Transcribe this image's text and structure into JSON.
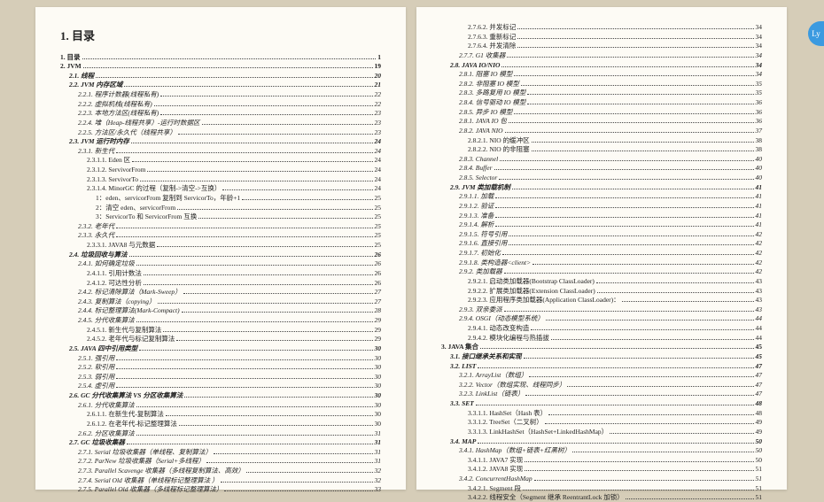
{
  "title": "1. 目录",
  "assist_label": "Ly",
  "left": [
    {
      "lvl": 0,
      "label": "1. 目录",
      "page": "1"
    },
    {
      "lvl": 0,
      "label": "2. JVM",
      "page": "19"
    },
    {
      "lvl": 1,
      "label": "2.1. 线程",
      "page": "20"
    },
    {
      "lvl": 1,
      "label": "2.2. JVM 内存区域",
      "page": "21"
    },
    {
      "lvl": 2,
      "label": "2.2.1. 程序计数器(线程私有)",
      "page": "22"
    },
    {
      "lvl": 2,
      "label": "2.2.2. 虚拟机栈(线程私有)",
      "page": "22"
    },
    {
      "lvl": 2,
      "label": "2.2.3. 本地方法区(线程私有)",
      "page": "23"
    },
    {
      "lvl": 2,
      "label": "2.2.4. 堆（Heap-线程共享）-运行时数据区",
      "page": "23"
    },
    {
      "lvl": 2,
      "label": "2.2.5. 方法区/永久代（线程共享）",
      "page": "23"
    },
    {
      "lvl": 1,
      "label": "2.3. JVM 运行时内存",
      "page": "24"
    },
    {
      "lvl": 2,
      "label": "2.3.1. 新生代",
      "page": "24"
    },
    {
      "lvl": 3,
      "label": "2.3.1.1. Eden 区",
      "page": "24"
    },
    {
      "lvl": 3,
      "label": "2.3.1.2. ServivorFrom",
      "page": "24"
    },
    {
      "lvl": 3,
      "label": "2.3.1.3. ServivorTo",
      "page": "24"
    },
    {
      "lvl": 3,
      "label": "2.3.1.4. MinorGC 的过程（复制->清空->互换）",
      "page": "24"
    },
    {
      "lvl": 4,
      "label": "1：eden、servicorFrom 复制到 ServicorTo，年龄+1",
      "page": "25"
    },
    {
      "lvl": 4,
      "label": "2：清空 eden、servicorFrom",
      "page": "25"
    },
    {
      "lvl": 4,
      "label": "3：ServicorTo 和 ServicorFrom 互换",
      "page": "25"
    },
    {
      "lvl": 2,
      "label": "2.3.2. 老年代",
      "page": "25"
    },
    {
      "lvl": 2,
      "label": "2.3.3. 永久代",
      "page": "25"
    },
    {
      "lvl": 3,
      "label": "2.3.3.1. JAVA8 与元数据",
      "page": "25"
    },
    {
      "lvl": 1,
      "label": "2.4. 垃圾回收与算法",
      "page": "26"
    },
    {
      "lvl": 2,
      "label": "2.4.1. 如何确定垃圾",
      "page": "26"
    },
    {
      "lvl": 3,
      "label": "2.4.1.1. 引用计数法",
      "page": "26"
    },
    {
      "lvl": 3,
      "label": "2.4.1.2. 可达性分析",
      "page": "26"
    },
    {
      "lvl": 2,
      "label": "2.4.2. 标记清除算法（Mark-Sweep）",
      "page": "27"
    },
    {
      "lvl": 2,
      "label": "2.4.3. 复制算法（copying）",
      "page": "27"
    },
    {
      "lvl": 2,
      "label": "2.4.4. 标记整理算法(Mark-Compact)",
      "page": "28"
    },
    {
      "lvl": 2,
      "label": "2.4.5. 分代收集算法",
      "page": "29"
    },
    {
      "lvl": 3,
      "label": "2.4.5.1. 新生代与复制算法",
      "page": "29"
    },
    {
      "lvl": 3,
      "label": "2.4.5.2. 老年代与标记复制算法",
      "page": "29"
    },
    {
      "lvl": 1,
      "label": "2.5. JAVA 四中引用类型",
      "page": "30"
    },
    {
      "lvl": 2,
      "label": "2.5.1. 强引用",
      "page": "30"
    },
    {
      "lvl": 2,
      "label": "2.5.2. 软引用",
      "page": "30"
    },
    {
      "lvl": 2,
      "label": "2.5.3. 弱引用",
      "page": "30"
    },
    {
      "lvl": 2,
      "label": "2.5.4. 虚引用",
      "page": "30"
    },
    {
      "lvl": 1,
      "label": "2.6. GC 分代收集算法 VS 分区收集算法",
      "page": "30"
    },
    {
      "lvl": 2,
      "label": "2.6.1. 分代收集算法",
      "page": "30"
    },
    {
      "lvl": 3,
      "label": "2.6.1.1. 在新生代-复制算法",
      "page": "30"
    },
    {
      "lvl": 3,
      "label": "2.6.1.2. 在老年代-标记整理算法",
      "page": "30"
    },
    {
      "lvl": 2,
      "label": "2.6.2. 分区收集算法",
      "page": "31"
    },
    {
      "lvl": 1,
      "label": "2.7. GC 垃圾收集器",
      "page": "31"
    },
    {
      "lvl": 2,
      "label": "2.7.1. Serial 垃圾收集器（单线程、复制算法）",
      "page": "31"
    },
    {
      "lvl": 2,
      "label": "2.7.2. ParNew 垃圾收集器（Serial+多线程）",
      "page": "31"
    },
    {
      "lvl": 2,
      "label": "2.7.3. Parallel Scavenge 收集器（多线程复制算法、高效）",
      "page": "32"
    },
    {
      "lvl": 2,
      "label": "2.7.4. Serial Old 收集器（单线程标记整理算法 ）",
      "page": "32"
    },
    {
      "lvl": 2,
      "label": "2.7.5. Parallel Old 收集器（多线程标记整理算法）",
      "page": "33"
    }
  ],
  "right": [
    {
      "lvl": 3,
      "label": "2.7.6.2. 并发标记",
      "page": "34"
    },
    {
      "lvl": 3,
      "label": "2.7.6.3. 重新标记",
      "page": "34"
    },
    {
      "lvl": 3,
      "label": "2.7.6.4. 并发清除",
      "page": "34"
    },
    {
      "lvl": 2,
      "label": "2.7.7. G1 收集器",
      "page": "34"
    },
    {
      "lvl": 1,
      "label": "2.8. JAVA IO/NIO",
      "page": "34"
    },
    {
      "lvl": 2,
      "label": "2.8.1. 阻塞 IO 模型",
      "page": "34"
    },
    {
      "lvl": 2,
      "label": "2.8.2. 非阻塞 IO 模型",
      "page": "35"
    },
    {
      "lvl": 2,
      "label": "2.8.3. 多路复用 IO 模型",
      "page": "35"
    },
    {
      "lvl": 2,
      "label": "2.8.4. 信号驱动 IO 模型",
      "page": "36"
    },
    {
      "lvl": 2,
      "label": "2.8.5. 异步 IO 模型",
      "page": "36"
    },
    {
      "lvl": 2,
      "label": "2.8.1. JAVA IO 包",
      "page": "36"
    },
    {
      "lvl": 2,
      "label": "2.8.2. JAVA NIO",
      "page": "37"
    },
    {
      "lvl": 3,
      "label": "2.8.2.1. NIO 的缓冲区",
      "page": "38"
    },
    {
      "lvl": 3,
      "label": "2.8.2.2. NIO 的非阻塞",
      "page": "38"
    },
    {
      "lvl": 2,
      "label": "2.8.3. Channel",
      "page": "40"
    },
    {
      "lvl": 2,
      "label": "2.8.4. Buffer",
      "page": "40"
    },
    {
      "lvl": 2,
      "label": "2.8.5. Selector",
      "page": "40"
    },
    {
      "lvl": 1,
      "label": "2.9. JVM 类加载机制",
      "page": "41"
    },
    {
      "lvl": 2,
      "label": "2.9.1.1. 加载",
      "page": "41"
    },
    {
      "lvl": 2,
      "label": "2.9.1.2. 验证",
      "page": "41"
    },
    {
      "lvl": 2,
      "label": "2.9.1.3. 准备",
      "page": "41"
    },
    {
      "lvl": 2,
      "label": "2.9.1.4. 解析",
      "page": "41"
    },
    {
      "lvl": 2,
      "label": "2.9.1.5. 符号引用",
      "page": "42"
    },
    {
      "lvl": 2,
      "label": "2.9.1.6. 直接引用",
      "page": "42"
    },
    {
      "lvl": 2,
      "label": "2.9.1.7. 初始化",
      "page": "42"
    },
    {
      "lvl": 2,
      "label": "2.9.1.8. 类构造器<client>",
      "page": "42"
    },
    {
      "lvl": 2,
      "label": "2.9.2. 类加载器",
      "page": "42"
    },
    {
      "lvl": 3,
      "label": "2.9.2.1. 启动类加载器(Bootstrap ClassLoader)",
      "page": "43"
    },
    {
      "lvl": 3,
      "label": "2.9.2.2. 扩展类加载器(Extension ClassLoader)",
      "page": "43"
    },
    {
      "lvl": 3,
      "label": "2.9.2.3. 应用程序类加载器(Application ClassLoader)：",
      "page": "43"
    },
    {
      "lvl": 2,
      "label": "2.9.3. 双亲委派",
      "page": "43"
    },
    {
      "lvl": 2,
      "label": "2.9.4. OSGI（动态模型系统）",
      "page": "44"
    },
    {
      "lvl": 3,
      "label": "2.9.4.1. 动态改变构造",
      "page": "44"
    },
    {
      "lvl": 3,
      "label": "2.9.4.2. 模块化编程与热插拔",
      "page": "44"
    },
    {
      "lvl": 0,
      "label": "3. JAVA 集合",
      "page": "45"
    },
    {
      "lvl": 1,
      "label": "3.1. 接口继承关系和实现",
      "page": "45"
    },
    {
      "lvl": 1,
      "label": "3.2. LIST",
      "page": "47"
    },
    {
      "lvl": 2,
      "label": "3.2.1. ArrayList（数组）",
      "page": "47"
    },
    {
      "lvl": 2,
      "label": "3.2.2. Vector（数组实现、线程同步）",
      "page": "47"
    },
    {
      "lvl": 2,
      "label": "3.2.3. LinkList（链表）",
      "page": "47"
    },
    {
      "lvl": 1,
      "label": "3.3. SET",
      "page": "48"
    },
    {
      "lvl": 3,
      "label": "3.3.1.1. HashSet（Hash 表）",
      "page": "48"
    },
    {
      "lvl": 3,
      "label": "3.3.1.2. TreeSet（二叉树）",
      "page": "49"
    },
    {
      "lvl": 3,
      "label": "3.3.1.3. LinkHashSet（HashSet+LinkedHashMap）",
      "page": "49"
    },
    {
      "lvl": 1,
      "label": "3.4. MAP",
      "page": "50"
    },
    {
      "lvl": 2,
      "label": "3.4.1. HashMap（数组+链表+红黑树）",
      "page": "50"
    },
    {
      "lvl": 3,
      "label": "3.4.1.1. JAVA7 实现",
      "page": "50"
    },
    {
      "lvl": 3,
      "label": "3.4.1.2. JAVA8 实现",
      "page": "51"
    },
    {
      "lvl": 2,
      "label": "3.4.2. ConcurrentHashMap",
      "page": "51"
    },
    {
      "lvl": 3,
      "label": "3.4.2.1. Segment 段",
      "page": "51"
    },
    {
      "lvl": 3,
      "label": "3.4.2.2. 线程安全（Segment 继承 ReentrantLock 加锁）",
      "page": "51"
    }
  ]
}
